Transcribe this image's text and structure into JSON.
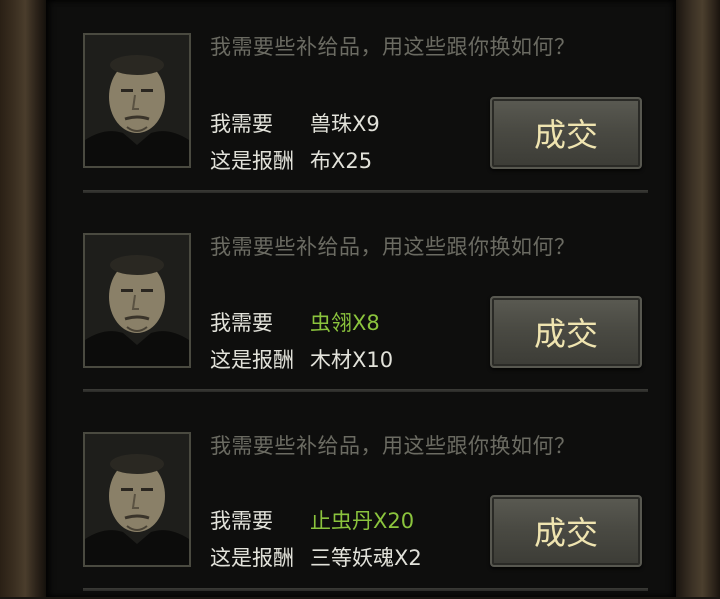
{
  "offers": [
    {
      "prompt": "我需要些补给品，用这些跟你换如何？",
      "need_label": "我需要",
      "need_item": "兽珠X9",
      "need_color": "#e2e2da",
      "reward_label": "这是报酬",
      "reward_item": "布X25",
      "button_label": "成交"
    },
    {
      "prompt": "我需要些补给品，用这些跟你换如何？",
      "need_label": "我需要",
      "need_item": "虫翎X8",
      "need_color": "#8bc43d",
      "reward_label": "这是报酬",
      "reward_item": "木材X10",
      "button_label": "成交"
    },
    {
      "prompt": "我需要些补给品，用这些跟你换如何？",
      "need_label": "我需要",
      "need_item": "止虫丹X20",
      "need_color": "#8bc43d",
      "reward_label": "这是报酬",
      "reward_item": "三等妖魂X2",
      "button_label": "成交"
    }
  ]
}
